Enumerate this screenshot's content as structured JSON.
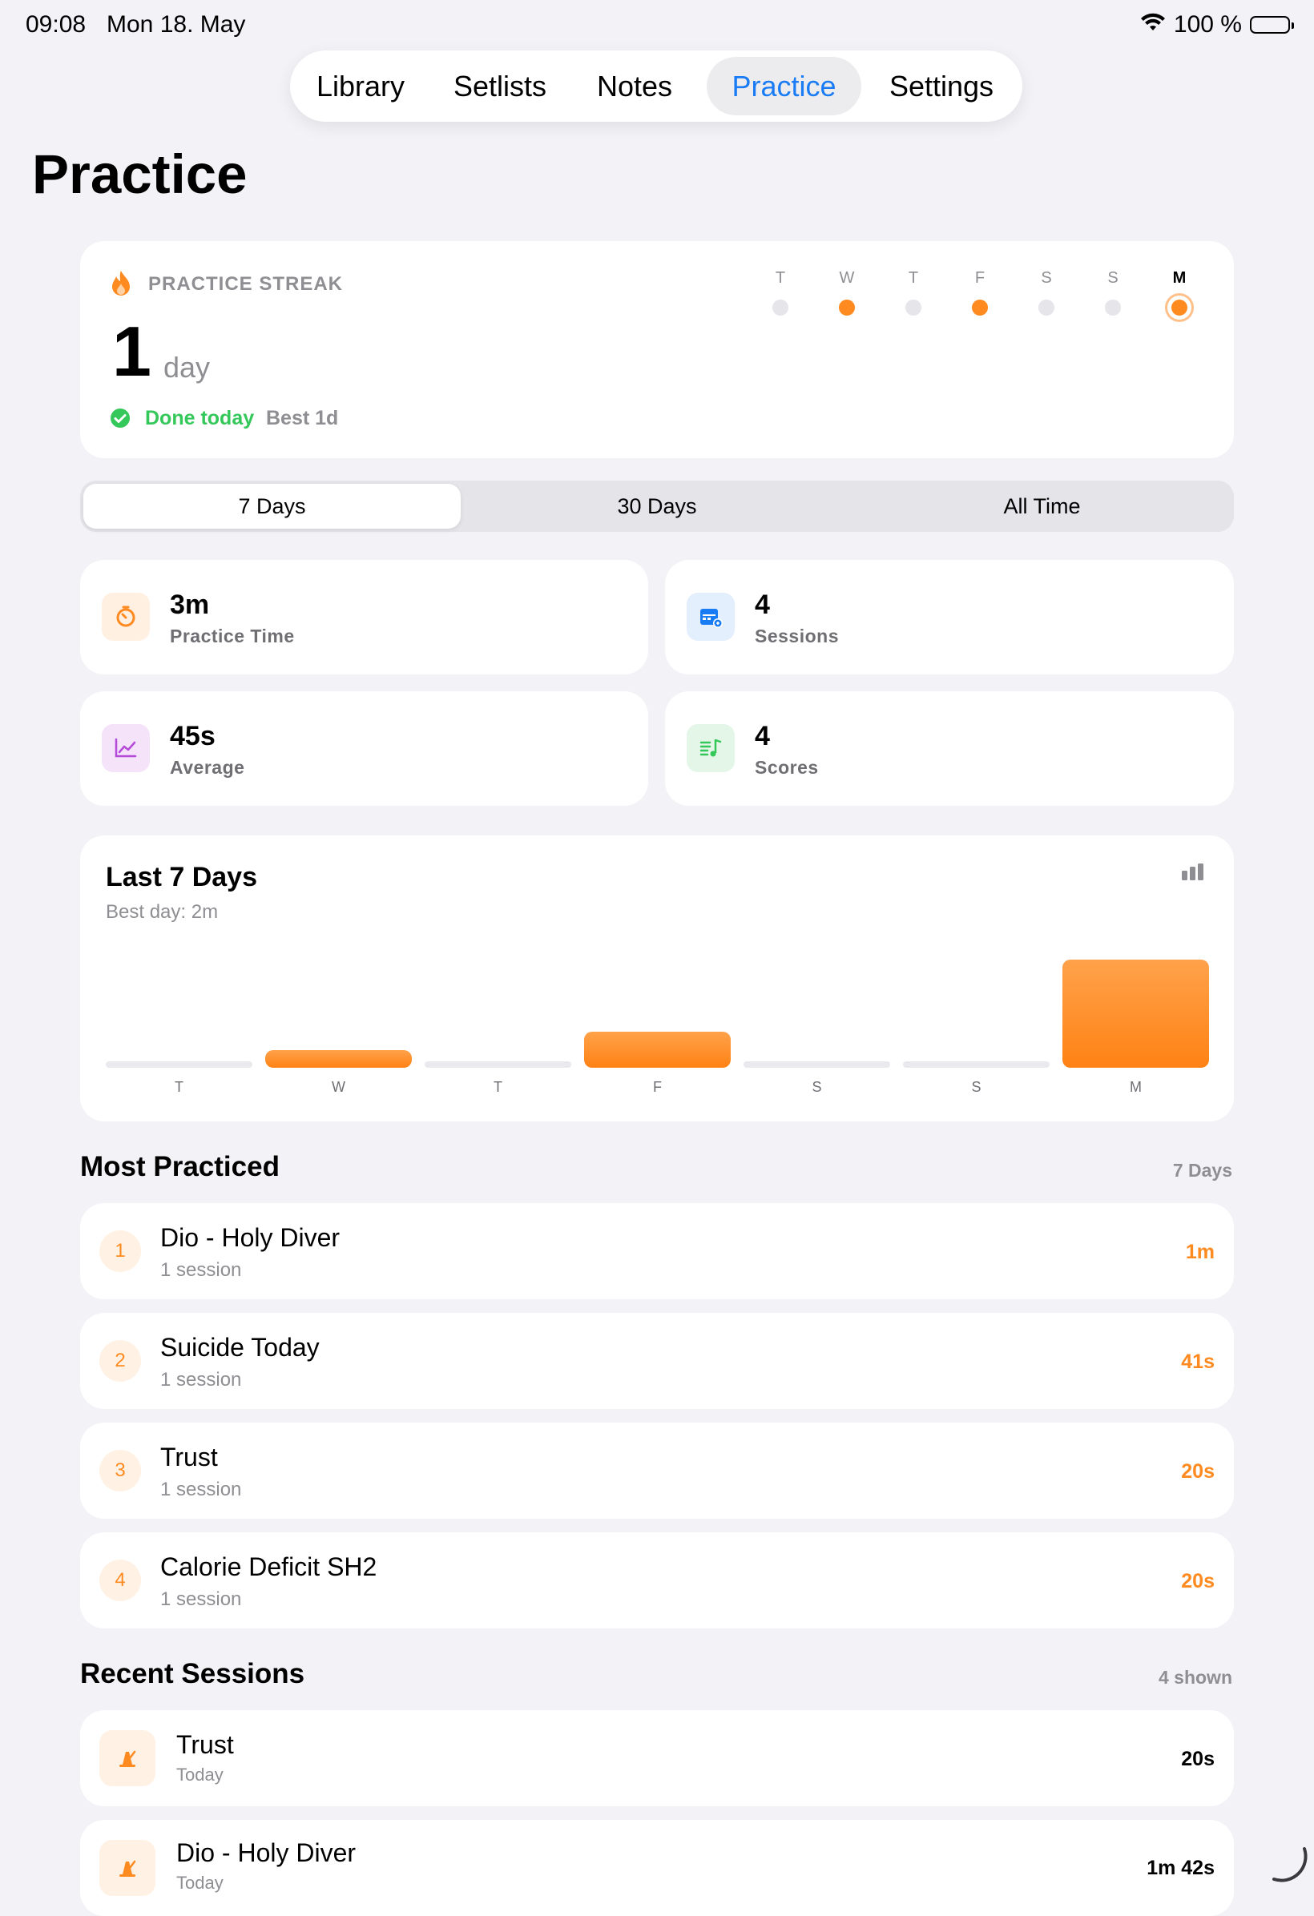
{
  "status": {
    "time": "09:08",
    "date": "Mon 18. May",
    "battery": "100 %"
  },
  "tabs": [
    {
      "label": "Library"
    },
    {
      "label": "Setlists"
    },
    {
      "label": "Notes"
    },
    {
      "label": "Practice",
      "active": true
    },
    {
      "label": "Settings"
    }
  ],
  "page_title": "Practice",
  "streak": {
    "label": "PRACTICE STREAK",
    "count": "1",
    "unit": "day",
    "done": "Done today",
    "best": "Best 1d",
    "days": [
      {
        "letter": "T",
        "practiced": false
      },
      {
        "letter": "W",
        "practiced": true
      },
      {
        "letter": "T",
        "practiced": false
      },
      {
        "letter": "F",
        "practiced": true
      },
      {
        "letter": "S",
        "practiced": false
      },
      {
        "letter": "S",
        "practiced": false
      },
      {
        "letter": "M",
        "practiced": true,
        "today": true
      }
    ]
  },
  "range": {
    "options": [
      "7 Days",
      "30 Days",
      "All Time"
    ],
    "selected": "7 Days"
  },
  "stats": [
    {
      "value": "3m",
      "label": "Practice Time",
      "icon": "timer-icon",
      "color": "#ff8a1f",
      "bg": "#fff0e2"
    },
    {
      "value": "4",
      "label": "Sessions",
      "icon": "calendar-icon",
      "color": "#1a7cf5",
      "bg": "#e3effd"
    },
    {
      "value": "45s",
      "label": "Average",
      "icon": "trend-chart-icon",
      "color": "#b64ad8",
      "bg": "#f5e3fa"
    },
    {
      "value": "4",
      "label": "Scores",
      "icon": "music-list-icon",
      "color": "#34c759",
      "bg": "#e3f6e8"
    }
  ],
  "chart": {
    "title": "Last 7 Days",
    "subtitle": "Best day: 2m",
    "icon": "bar-chart-icon"
  },
  "chart_data": {
    "type": "bar",
    "categories": [
      "T",
      "W",
      "T",
      "F",
      "S",
      "S",
      "M"
    ],
    "values": [
      0,
      20,
      0,
      41,
      0,
      0,
      122
    ],
    "ylim": [
      0,
      122
    ]
  },
  "most_practiced": {
    "title": "Most Practiced",
    "meta": "7 Days",
    "items": [
      {
        "rank": "1",
        "title": "Dio - Holy Diver",
        "sub": "1 session",
        "time": "1m"
      },
      {
        "rank": "2",
        "title": "Suicide Today",
        "sub": "1 session",
        "time": "41s"
      },
      {
        "rank": "3",
        "title": "Trust",
        "sub": "1 session",
        "time": "20s"
      },
      {
        "rank": "4",
        "title": "Calorie Deficit SH2",
        "sub": "1 session",
        "time": "20s"
      }
    ]
  },
  "recent": {
    "title": "Recent Sessions",
    "meta": "4 shown",
    "items": [
      {
        "title": "Trust",
        "sub": "Today",
        "time": "20s"
      },
      {
        "title": "Dio - Holy Diver",
        "sub": "Today",
        "time": "1m 42s"
      }
    ]
  }
}
